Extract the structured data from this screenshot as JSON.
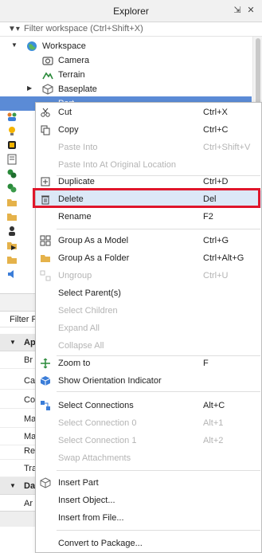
{
  "window": {
    "title": "Explorer",
    "pin_icon": "pin-icon",
    "close_icon": "close-icon"
  },
  "filter": {
    "placeholder": "Filter workspace (Ctrl+Shift+X)"
  },
  "tree": {
    "items": [
      {
        "label": "Workspace",
        "icon": "globe-icon"
      },
      {
        "label": "Camera",
        "icon": "camera-icon"
      },
      {
        "label": "Terrain",
        "icon": "terrain-icon"
      },
      {
        "label": "Baseplate",
        "icon": "part-icon"
      },
      {
        "label": "Part",
        "icon": "part-icon"
      }
    ]
  },
  "properties": {
    "filter_label": "Filter P",
    "sections": [
      {
        "label": "Ap"
      },
      {
        "label": "Da"
      }
    ],
    "rows": [
      "Br",
      "Ca",
      "Co",
      "Ma",
      "Ma",
      "Re",
      "Tra",
      "Ar"
    ]
  },
  "menu": {
    "items": [
      {
        "label": "Cut",
        "shortcut": "Ctrl+X",
        "enabled": true,
        "icon": "scissors-icon"
      },
      {
        "label": "Copy",
        "shortcut": "Ctrl+C",
        "enabled": true,
        "icon": "copy-icon"
      },
      {
        "label": "Paste Into",
        "shortcut": "Ctrl+Shift+V",
        "enabled": false
      },
      {
        "label": "Paste Into At Original Location",
        "shortcut": "",
        "enabled": false
      },
      {
        "label": "Duplicate",
        "shortcut": "Ctrl+D",
        "enabled": true,
        "icon": "duplicate-icon"
      },
      {
        "label": "Delete",
        "shortcut": "Del",
        "enabled": true,
        "icon": "trash-icon"
      },
      {
        "label": "Rename",
        "shortcut": "F2",
        "enabled": true
      },
      {
        "label": "Group As a Model",
        "shortcut": "Ctrl+G",
        "enabled": true,
        "icon": "model-icon"
      },
      {
        "label": "Group As a Folder",
        "shortcut": "Ctrl+Alt+G",
        "enabled": true,
        "icon": "folder-icon"
      },
      {
        "label": "Ungroup",
        "shortcut": "Ctrl+U",
        "enabled": false,
        "icon": "ungroup-icon"
      },
      {
        "label": "Select Parent(s)",
        "shortcut": "",
        "enabled": true
      },
      {
        "label": "Select Children",
        "shortcut": "",
        "enabled": false
      },
      {
        "label": "Expand All",
        "shortcut": "",
        "enabled": false
      },
      {
        "label": "Collapse All",
        "shortcut": "",
        "enabled": false
      },
      {
        "label": "Zoom to",
        "shortcut": "F",
        "enabled": true,
        "icon": "zoom-icon"
      },
      {
        "label": "Show Orientation Indicator",
        "shortcut": "",
        "enabled": true,
        "icon": "orientation-icon"
      },
      {
        "label": "Select Connections",
        "shortcut": "Alt+C",
        "enabled": true,
        "icon": "connections-icon"
      },
      {
        "label": "Select Connection 0",
        "shortcut": "Alt+1",
        "enabled": false
      },
      {
        "label": "Select Connection 1",
        "shortcut": "Alt+2",
        "enabled": false
      },
      {
        "label": "Swap Attachments",
        "shortcut": "",
        "enabled": false
      },
      {
        "label": "Insert Part",
        "shortcut": "",
        "enabled": true,
        "icon": "insert-part-icon"
      },
      {
        "label": "Insert Object...",
        "shortcut": "",
        "enabled": true
      },
      {
        "label": "Insert from File...",
        "shortcut": "",
        "enabled": true
      },
      {
        "label": "Convert to Package...",
        "shortcut": "",
        "enabled": true
      }
    ],
    "highlighted": "Delete",
    "highlight_color": "#e0162b"
  }
}
